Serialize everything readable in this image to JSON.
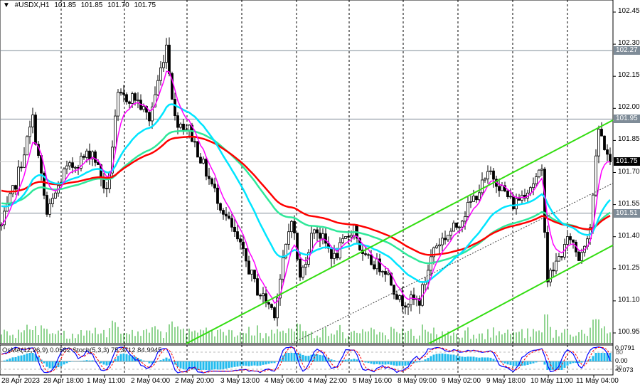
{
  "header": {
    "symbol": "#USDX,H1",
    "open": "101.85",
    "high": "101.85",
    "low": "101.70",
    "close": "101.75"
  },
  "subwindow": {
    "osma_label": "OsMA(12,26,9) 0.0582",
    "stoch_label": "Stoch(5,3,3) 75.3712 84.9945",
    "scale_labels": [
      "0.0791",
      "80",
      "0.00",
      "20",
      "-0.073"
    ]
  },
  "price_labels": [
    {
      "value": "102.27",
      "kind": "line"
    },
    {
      "value": "101.95",
      "kind": "line"
    },
    {
      "value": "101.75",
      "kind": "current"
    },
    {
      "value": "101.51",
      "kind": "line"
    }
  ],
  "colors": {
    "bull": "#ffffff",
    "bear": "#000000",
    "ma_fast": "#ff00ff",
    "ma_mid": "#00e5ff",
    "ma_slow": "#2ee89a",
    "ma_long": "#ff0000",
    "channel": "#33dd11",
    "volume": "#22aa22",
    "osma": "#22bbee",
    "stoch_main": "#0000ff",
    "stoch_signal": "#ff0000",
    "label_bg": "#7f8c98"
  },
  "chart_data": {
    "type": "candlestick",
    "title": "#USDX,H1",
    "ylim": [
      100.9,
      102.5
    ],
    "y_ticks": [
      "102.45",
      "102.30",
      "102.15",
      "102.00",
      "101.85",
      "101.70",
      "101.55",
      "101.40",
      "101.25",
      "101.10",
      "100.95"
    ],
    "x_labels": [
      "28 Apr 2023",
      "28 Apr 18:00",
      "1 May 11:00",
      "2 May 04:00",
      "2 May 20:00",
      "3 May 13:00",
      "4 May 06:00",
      "4 May 22:00",
      "5 May 16:00",
      "8 May 09:00",
      "9 May 02:00",
      "9 May 18:00",
      "10 May 11:00",
      "11 May 04:00"
    ],
    "bars": 215,
    "close_path": [
      [
        0,
        101.45
      ],
      [
        5,
        101.65
      ],
      [
        11,
        101.95
      ],
      [
        16,
        101.5
      ],
      [
        22,
        101.7
      ],
      [
        32,
        101.8
      ],
      [
        37,
        101.6
      ],
      [
        41,
        102.05
      ],
      [
        47,
        102.05
      ],
      [
        52,
        101.95
      ],
      [
        58,
        102.3
      ],
      [
        61,
        101.95
      ],
      [
        66,
        101.9
      ],
      [
        72,
        101.7
      ],
      [
        77,
        101.55
      ],
      [
        84,
        101.35
      ],
      [
        90,
        101.15
      ],
      [
        96,
        101.05
      ],
      [
        102,
        101.5
      ],
      [
        105,
        101.2
      ],
      [
        110,
        101.45
      ],
      [
        117,
        101.3
      ],
      [
        124,
        101.45
      ],
      [
        127,
        101.3
      ],
      [
        135,
        101.25
      ],
      [
        140,
        101.1
      ],
      [
        147,
        101.1
      ],
      [
        152,
        101.35
      ],
      [
        160,
        101.45
      ],
      [
        167,
        101.6
      ],
      [
        172,
        101.7
      ],
      [
        180,
        101.55
      ],
      [
        190,
        101.7
      ],
      [
        192,
        101.2
      ],
      [
        200,
        101.4
      ],
      [
        203,
        101.3
      ],
      [
        207,
        101.45
      ],
      [
        210,
        101.9
      ],
      [
        214,
        101.75
      ]
    ],
    "moving_averages": [
      {
        "name": "fast",
        "period": 6,
        "start": 101.45
      },
      {
        "name": "mid",
        "period": 25,
        "start": 101.55
      },
      {
        "name": "slow",
        "period": 55,
        "start": 101.56
      },
      {
        "name": "long",
        "period": 70,
        "start": 101.62
      }
    ],
    "horizontal_lines": [
      102.27,
      101.95,
      101.75,
      101.51
    ],
    "channel_lines": [
      {
        "name": "upper",
        "from": [
          65.5,
          100.9
        ],
        "to": [
          215.5,
          101.945
        ]
      },
      {
        "name": "middle",
        "from": [
          102.5,
          100.9
        ],
        "to": [
          215.5,
          101.65
        ],
        "style": "dotted"
      },
      {
        "name": "lower",
        "from": [
          150.75,
          100.9
        ],
        "to": [
          215.5,
          101.36
        ]
      }
    ]
  }
}
